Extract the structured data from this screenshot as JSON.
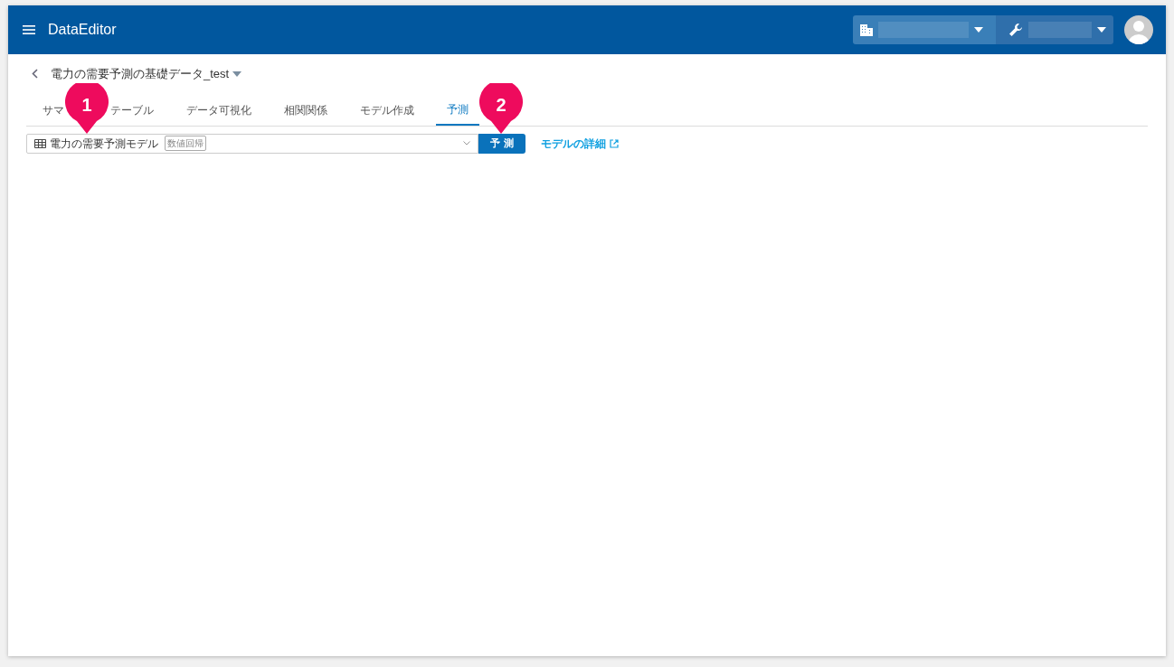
{
  "app_bar": {
    "title": "DataEditor"
  },
  "dataset": {
    "title": "電力の需要予測の基礎データ_test"
  },
  "tabs": [
    {
      "label": "サマ",
      "selected": false
    },
    {
      "label": "テーブル",
      "selected": false
    },
    {
      "label": "データ可視化",
      "selected": false
    },
    {
      "label": "相関関係",
      "selected": false
    },
    {
      "label": "モデル作成",
      "selected": false
    },
    {
      "label": "予測",
      "selected": true
    }
  ],
  "model_select": {
    "value": "電力の需要予測モデル",
    "tag": "数値回帰"
  },
  "predict_button": "予 測",
  "details_link": "モデルの詳細",
  "markers": [
    "1",
    "2"
  ]
}
